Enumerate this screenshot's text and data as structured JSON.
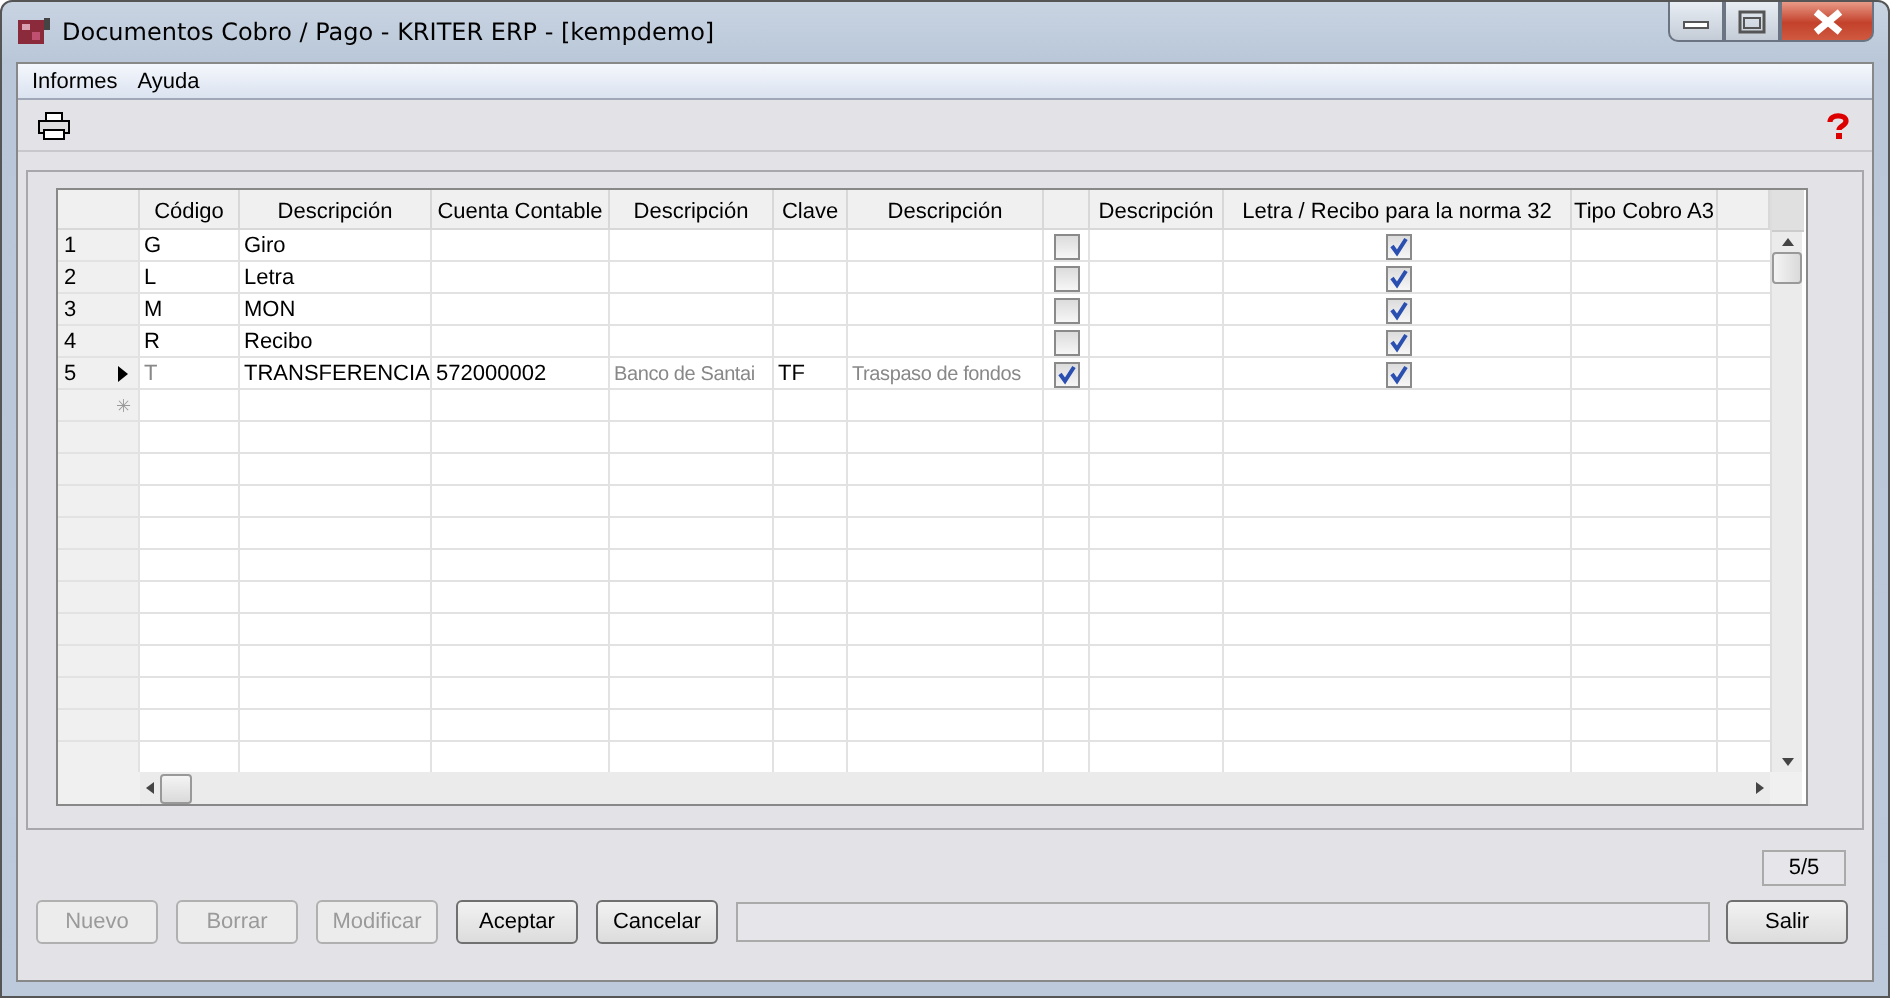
{
  "window": {
    "title": "Documentos Cobro / Pago - KRITER ERP - [kempdemo]"
  },
  "menu": [
    "Informes",
    "Ayuda"
  ],
  "table": {
    "columns": [
      "Código",
      "Descripción",
      "Cuenta Contable",
      "Descripción",
      "Clave",
      "Descripción",
      "",
      "Descripción",
      "Letra / Recibo para la norma 32",
      "Tipo Cobro A3"
    ],
    "rows": [
      {
        "number": "1",
        "current": false,
        "code": "G",
        "code_disabled": false,
        "description": "Giro",
        "account": "",
        "account_description": "",
        "key": "",
        "key_description": "",
        "check": false,
        "description_2": "",
        "letter_receipt": true,
        "type_a3": ""
      },
      {
        "number": "2",
        "current": false,
        "code": "L",
        "code_disabled": false,
        "description": "Letra",
        "account": "",
        "account_description": "",
        "key": "",
        "key_description": "",
        "check": false,
        "description_2": "",
        "letter_receipt": true,
        "type_a3": ""
      },
      {
        "number": "3",
        "current": false,
        "code": "M",
        "code_disabled": false,
        "description": "MON",
        "account": "",
        "account_description": "",
        "key": "",
        "key_description": "",
        "check": false,
        "description_2": "",
        "letter_receipt": true,
        "type_a3": ""
      },
      {
        "number": "4",
        "current": false,
        "code": "R",
        "code_disabled": false,
        "description": "Recibo",
        "account": "",
        "account_description": "",
        "key": "",
        "key_description": "",
        "check": false,
        "description_2": "",
        "letter_receipt": true,
        "type_a3": ""
      },
      {
        "number": "5",
        "current": true,
        "code": "T",
        "code_disabled": true,
        "description": "TRANSFERENCIA",
        "account": "572000002",
        "account_description": "Banco de Santai",
        "key": "TF",
        "key_description": "Traspaso de fondos",
        "check": true,
        "description_2": "",
        "letter_receipt": true,
        "type_a3": ""
      }
    ],
    "new_row_marker": "✳"
  },
  "record_counter": "5/5",
  "buttons": [
    {
      "label": "Nuevo",
      "disabled": true
    },
    {
      "label": "Borrar",
      "disabled": true
    },
    {
      "label": "Modificar",
      "disabled": true
    },
    {
      "label": "Aceptar",
      "disabled": false
    },
    {
      "label": "Cancelar",
      "disabled": false
    }
  ],
  "exit_button": {
    "label": "Salir",
    "disabled": false
  }
}
